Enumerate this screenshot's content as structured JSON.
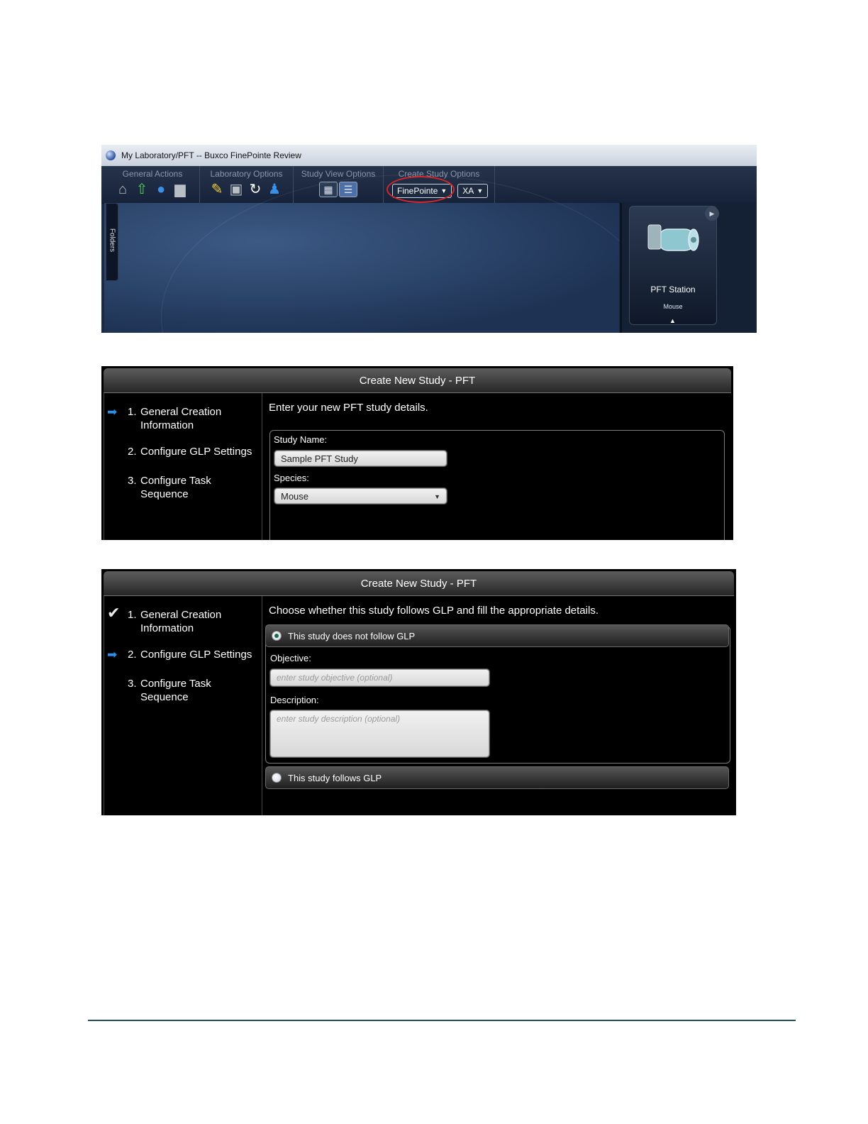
{
  "main_window": {
    "title": "My Laboratory/PFT -- Buxco FinePointe Review",
    "ribbon": {
      "general_actions": {
        "label": "General Actions",
        "icons": [
          "home-icon",
          "up-arrow-icon",
          "chat-bubble-icon",
          "printer-icon"
        ]
      },
      "laboratory_options": {
        "label": "Laboratory Options",
        "icons": [
          "pencil-icon",
          "add-station-icon",
          "refresh-icon",
          "user-icon"
        ]
      },
      "study_view_options": {
        "label": "Study View Options",
        "icons": [
          "grid-view-icon",
          "list-view-icon"
        ]
      },
      "create_study_options": {
        "label": "Create Study Options",
        "finepointe": "FinePointe",
        "xa": "XA"
      }
    },
    "folders_tab": "Folders",
    "station": {
      "name": "PFT Station",
      "species": "Mouse"
    }
  },
  "dialog1": {
    "title": "Create New Study - PFT",
    "steps": [
      {
        "num": "1.",
        "label": "General Creation Information"
      },
      {
        "num": "2.",
        "label": "Configure GLP Settings"
      },
      {
        "num": "3.",
        "label": "Configure Task Sequence"
      }
    ],
    "intro": "Enter your new PFT study details.",
    "study_name_label": "Study Name:",
    "study_name_value": "Sample PFT Study",
    "species_label": "Species:",
    "species_value": "Mouse"
  },
  "dialog2": {
    "title": "Create New Study - PFT",
    "steps": [
      {
        "num": "1.",
        "label": "General Creation Information"
      },
      {
        "num": "2.",
        "label": "Configure GLP Settings"
      },
      {
        "num": "3.",
        "label": "Configure Task Sequence"
      }
    ],
    "intro": "Choose whether this study follows GLP and fill the appropriate details.",
    "option_no_glp": "This study does not follow GLP",
    "objective_label": "Objective:",
    "objective_placeholder": "enter study objective (optional)",
    "description_label": "Description:",
    "description_placeholder": "enter study description (optional)",
    "option_glp": "This study follows GLP"
  }
}
